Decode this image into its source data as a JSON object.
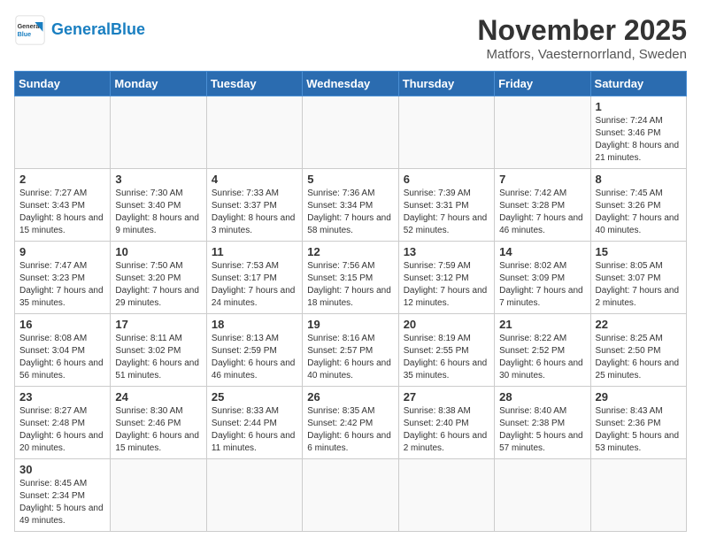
{
  "header": {
    "logo_general": "General",
    "logo_blue": "Blue",
    "month": "November 2025",
    "location": "Matfors, Vaesternorrland, Sweden"
  },
  "weekdays": [
    "Sunday",
    "Monday",
    "Tuesday",
    "Wednesday",
    "Thursday",
    "Friday",
    "Saturday"
  ],
  "weeks": [
    [
      {
        "day": "",
        "info": ""
      },
      {
        "day": "",
        "info": ""
      },
      {
        "day": "",
        "info": ""
      },
      {
        "day": "",
        "info": ""
      },
      {
        "day": "",
        "info": ""
      },
      {
        "day": "",
        "info": ""
      },
      {
        "day": "1",
        "info": "Sunrise: 7:24 AM\nSunset: 3:46 PM\nDaylight: 8 hours and 21 minutes."
      }
    ],
    [
      {
        "day": "2",
        "info": "Sunrise: 7:27 AM\nSunset: 3:43 PM\nDaylight: 8 hours and 15 minutes."
      },
      {
        "day": "3",
        "info": "Sunrise: 7:30 AM\nSunset: 3:40 PM\nDaylight: 8 hours and 9 minutes."
      },
      {
        "day": "4",
        "info": "Sunrise: 7:33 AM\nSunset: 3:37 PM\nDaylight: 8 hours and 3 minutes."
      },
      {
        "day": "5",
        "info": "Sunrise: 7:36 AM\nSunset: 3:34 PM\nDaylight: 7 hours and 58 minutes."
      },
      {
        "day": "6",
        "info": "Sunrise: 7:39 AM\nSunset: 3:31 PM\nDaylight: 7 hours and 52 minutes."
      },
      {
        "day": "7",
        "info": "Sunrise: 7:42 AM\nSunset: 3:28 PM\nDaylight: 7 hours and 46 minutes."
      },
      {
        "day": "8",
        "info": "Sunrise: 7:45 AM\nSunset: 3:26 PM\nDaylight: 7 hours and 40 minutes."
      }
    ],
    [
      {
        "day": "9",
        "info": "Sunrise: 7:47 AM\nSunset: 3:23 PM\nDaylight: 7 hours and 35 minutes."
      },
      {
        "day": "10",
        "info": "Sunrise: 7:50 AM\nSunset: 3:20 PM\nDaylight: 7 hours and 29 minutes."
      },
      {
        "day": "11",
        "info": "Sunrise: 7:53 AM\nSunset: 3:17 PM\nDaylight: 7 hours and 24 minutes."
      },
      {
        "day": "12",
        "info": "Sunrise: 7:56 AM\nSunset: 3:15 PM\nDaylight: 7 hours and 18 minutes."
      },
      {
        "day": "13",
        "info": "Sunrise: 7:59 AM\nSunset: 3:12 PM\nDaylight: 7 hours and 12 minutes."
      },
      {
        "day": "14",
        "info": "Sunrise: 8:02 AM\nSunset: 3:09 PM\nDaylight: 7 hours and 7 minutes."
      },
      {
        "day": "15",
        "info": "Sunrise: 8:05 AM\nSunset: 3:07 PM\nDaylight: 7 hours and 2 minutes."
      }
    ],
    [
      {
        "day": "16",
        "info": "Sunrise: 8:08 AM\nSunset: 3:04 PM\nDaylight: 6 hours and 56 minutes."
      },
      {
        "day": "17",
        "info": "Sunrise: 8:11 AM\nSunset: 3:02 PM\nDaylight: 6 hours and 51 minutes."
      },
      {
        "day": "18",
        "info": "Sunrise: 8:13 AM\nSunset: 2:59 PM\nDaylight: 6 hours and 46 minutes."
      },
      {
        "day": "19",
        "info": "Sunrise: 8:16 AM\nSunset: 2:57 PM\nDaylight: 6 hours and 40 minutes."
      },
      {
        "day": "20",
        "info": "Sunrise: 8:19 AM\nSunset: 2:55 PM\nDaylight: 6 hours and 35 minutes."
      },
      {
        "day": "21",
        "info": "Sunrise: 8:22 AM\nSunset: 2:52 PM\nDaylight: 6 hours and 30 minutes."
      },
      {
        "day": "22",
        "info": "Sunrise: 8:25 AM\nSunset: 2:50 PM\nDaylight: 6 hours and 25 minutes."
      }
    ],
    [
      {
        "day": "23",
        "info": "Sunrise: 8:27 AM\nSunset: 2:48 PM\nDaylight: 6 hours and 20 minutes."
      },
      {
        "day": "24",
        "info": "Sunrise: 8:30 AM\nSunset: 2:46 PM\nDaylight: 6 hours and 15 minutes."
      },
      {
        "day": "25",
        "info": "Sunrise: 8:33 AM\nSunset: 2:44 PM\nDaylight: 6 hours and 11 minutes."
      },
      {
        "day": "26",
        "info": "Sunrise: 8:35 AM\nSunset: 2:42 PM\nDaylight: 6 hours and 6 minutes."
      },
      {
        "day": "27",
        "info": "Sunrise: 8:38 AM\nSunset: 2:40 PM\nDaylight: 6 hours and 2 minutes."
      },
      {
        "day": "28",
        "info": "Sunrise: 8:40 AM\nSunset: 2:38 PM\nDaylight: 5 hours and 57 minutes."
      },
      {
        "day": "29",
        "info": "Sunrise: 8:43 AM\nSunset: 2:36 PM\nDaylight: 5 hours and 53 minutes."
      }
    ],
    [
      {
        "day": "30",
        "info": "Sunrise: 8:45 AM\nSunset: 2:34 PM\nDaylight: 5 hours and 49 minutes."
      },
      {
        "day": "",
        "info": ""
      },
      {
        "day": "",
        "info": ""
      },
      {
        "day": "",
        "info": ""
      },
      {
        "day": "",
        "info": ""
      },
      {
        "day": "",
        "info": ""
      },
      {
        "day": "",
        "info": ""
      }
    ]
  ]
}
